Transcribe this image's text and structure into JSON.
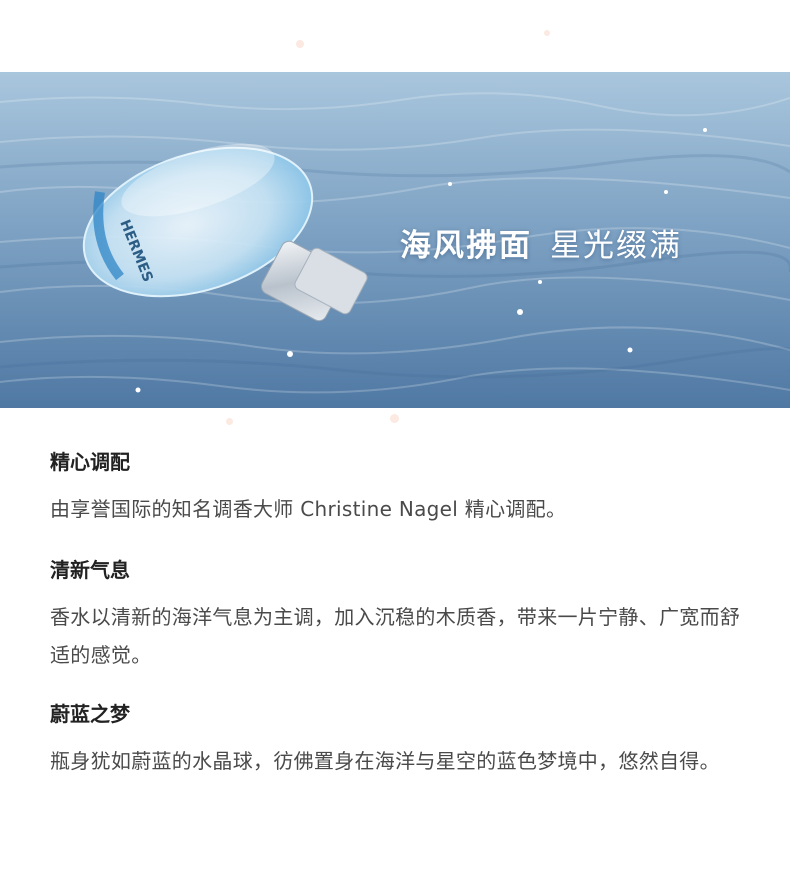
{
  "hero": {
    "title_bold": "海风拂面",
    "title_light": "星光缀满",
    "bottle_brand_text": "HERMES"
  },
  "sections": [
    {
      "heading": "精心调配",
      "body": "由享誉国际的知名调香大师 Christine Nagel 精心调配。"
    },
    {
      "heading": "清新气息",
      "body": "香水以清新的海洋气息为主调，加入沉稳的木质香，带来一片宁静、广宽而舒适的感觉。"
    },
    {
      "heading": "蔚蓝之梦",
      "body": "瓶身犹如蔚蓝的水晶球，彷佛置身在海洋与星空的蓝色梦境中，悠然自得。"
    }
  ]
}
